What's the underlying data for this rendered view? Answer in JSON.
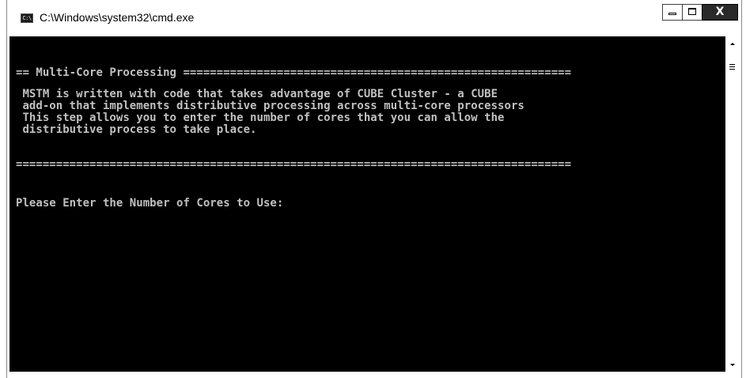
{
  "window": {
    "title": "C:\\Windows\\system32\\cmd.exe",
    "icon": "cmd-app-icon",
    "icon_label": "C:\\"
  },
  "caption_buttons": {
    "minimize": "minimize-icon",
    "maximize": "maximize-icon",
    "close": "close-icon",
    "close_glyph": "X"
  },
  "console": {
    "background": "#000000",
    "text_color": "#c0c0c0",
    "lines": [
      "== Multi-Core Processing ==========================================================",
      " MSTM is written with code that takes advantage of CUBE Cluster - a CUBE",
      " add-on that implements distributive processing across multi-core processors",
      " This step allows you to enter the number of cores that you can allow the",
      " distributive process to take place.",
      "===================================================================================",
      "Please Enter the Number of Cores to Use:"
    ]
  },
  "scrollbar": {
    "up": "scroll-up-arrow-icon",
    "down": "scroll-down-arrow-icon"
  }
}
